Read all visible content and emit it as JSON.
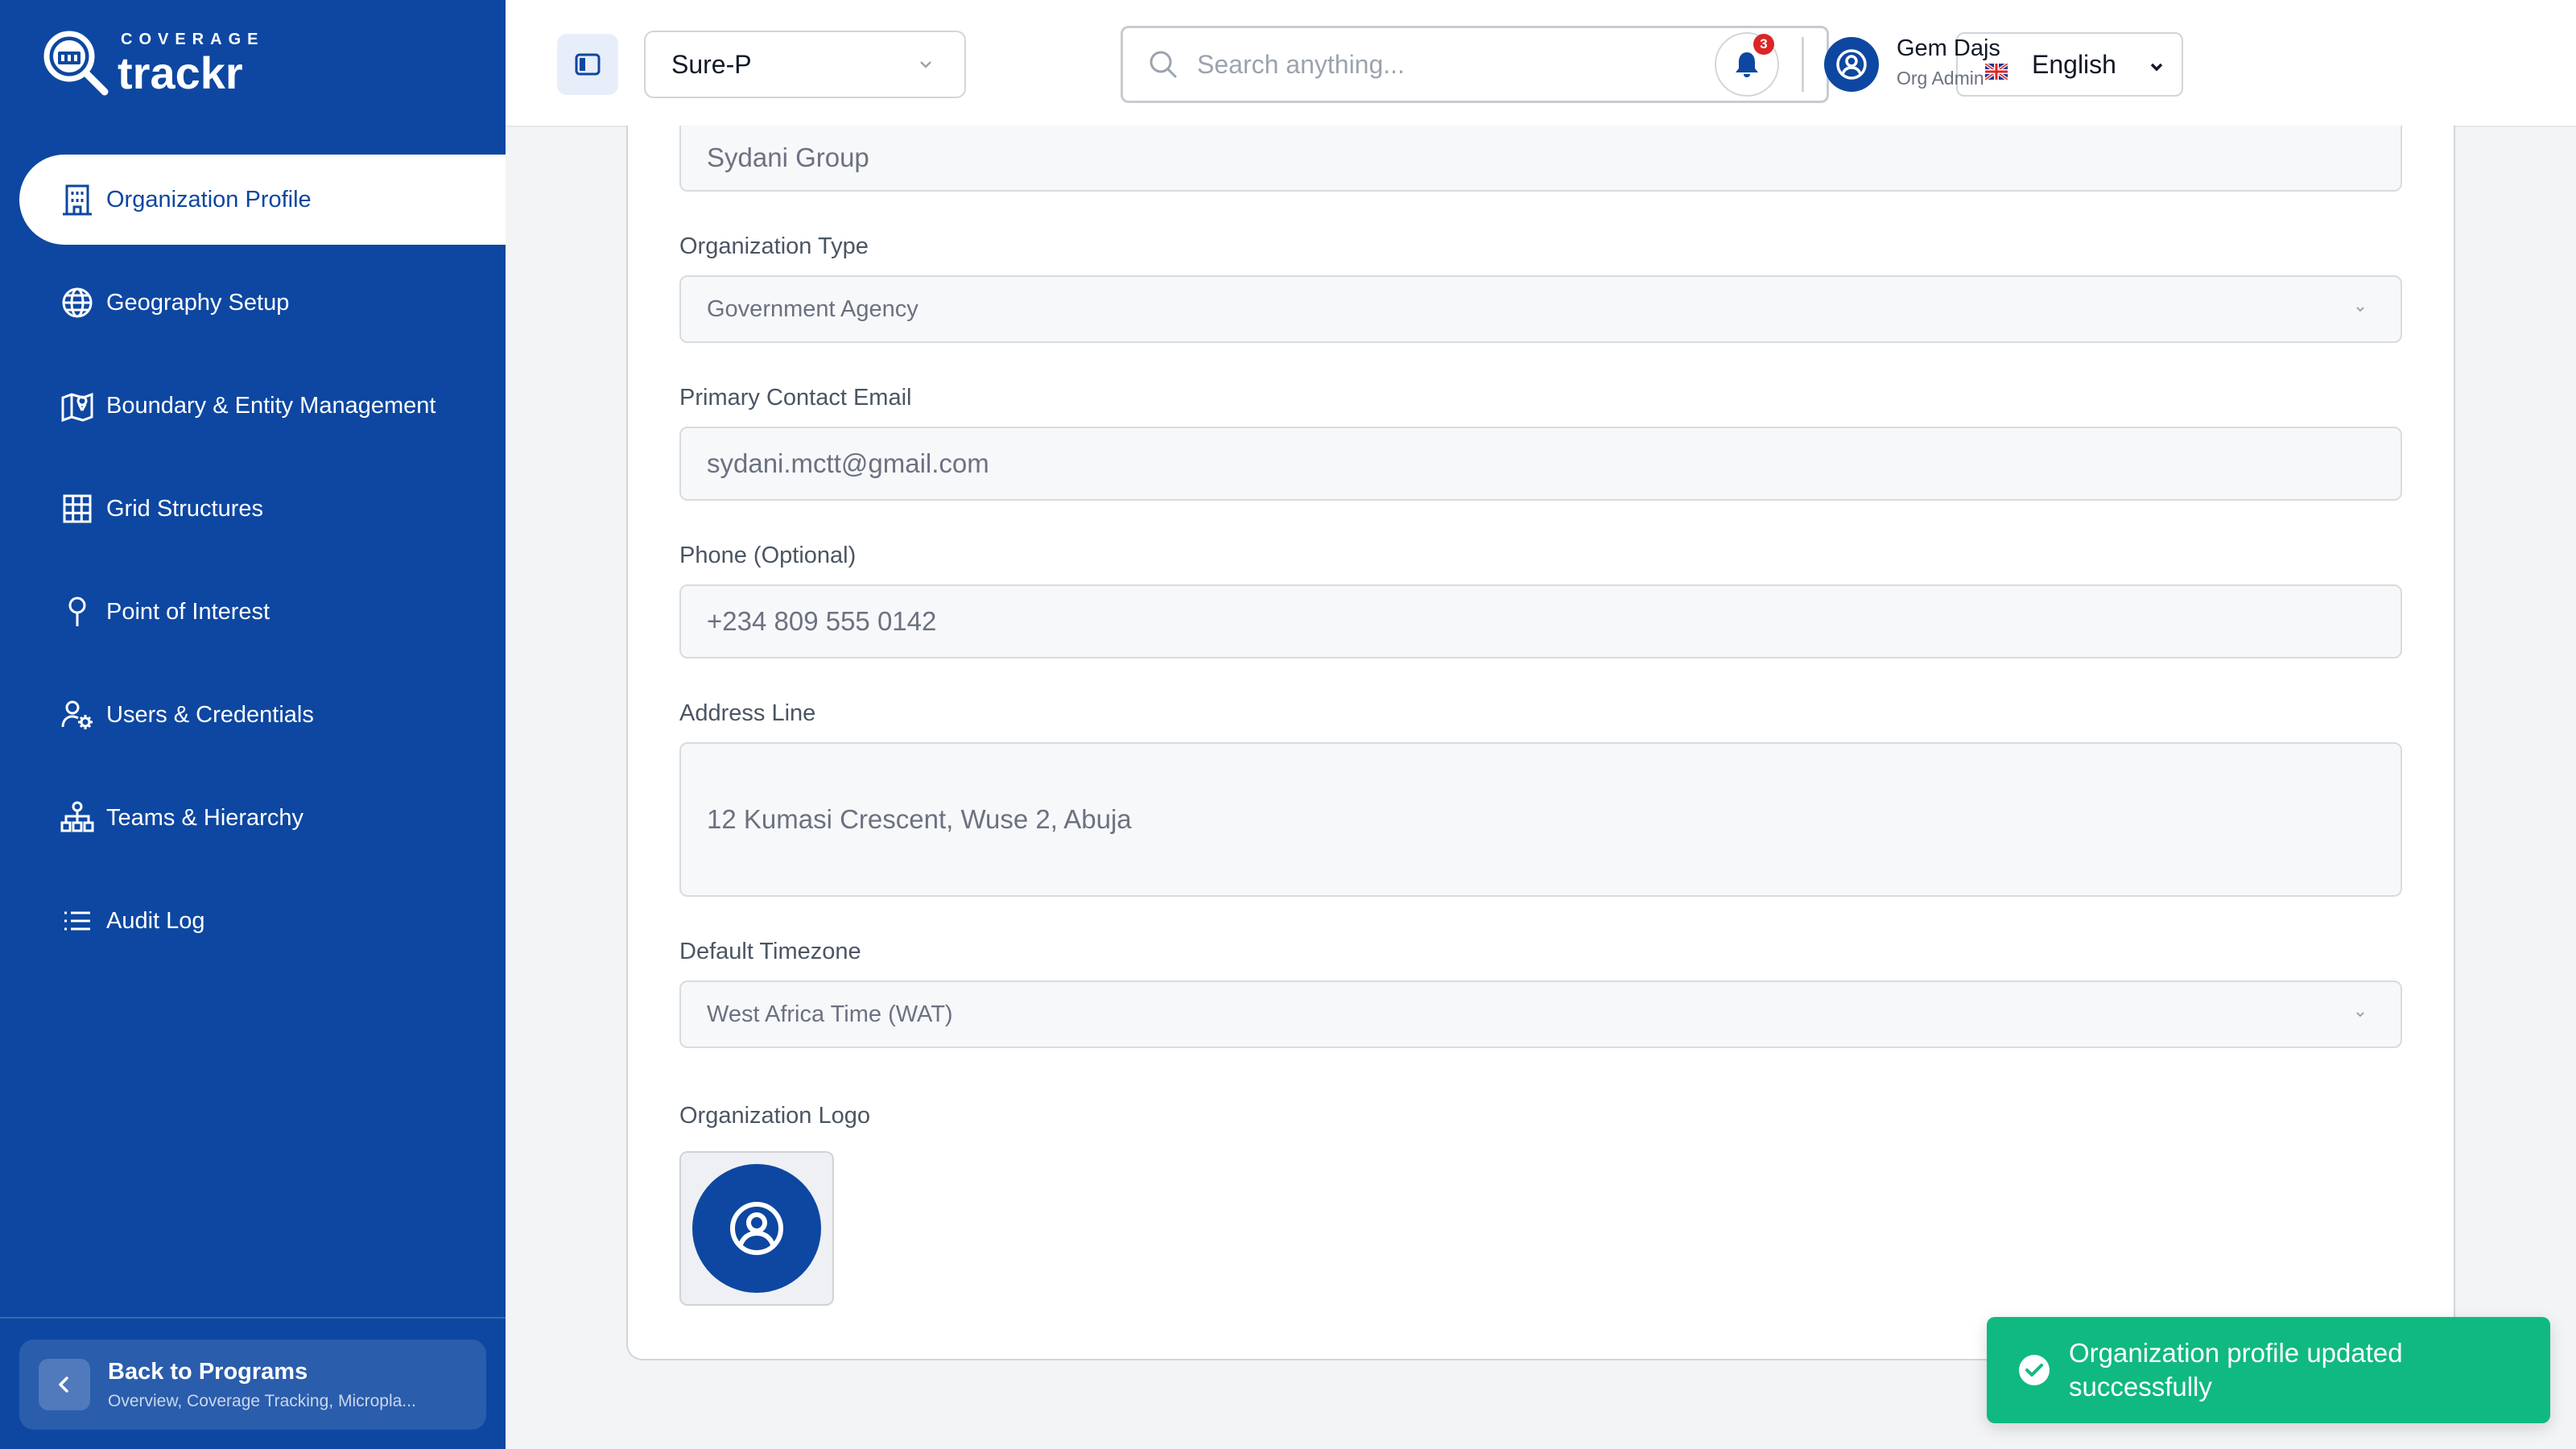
{
  "brand": {
    "small": "COVERAGE",
    "large": "trackr"
  },
  "sidebar": {
    "items": [
      {
        "label": "Organization Profile",
        "icon": "building-icon",
        "active": true
      },
      {
        "label": "Geography Setup",
        "icon": "globe-icon"
      },
      {
        "label": "Boundary & Entity Management",
        "icon": "map-pin-icon"
      },
      {
        "label": "Grid Structures",
        "icon": "grid-icon"
      },
      {
        "label": "Point of Interest",
        "icon": "location-pin-icon"
      },
      {
        "label": "Users & Credentials",
        "icon": "user-settings-icon"
      },
      {
        "label": "Teams & Hierarchy",
        "icon": "hierarchy-icon"
      },
      {
        "label": "Audit Log",
        "icon": "list-icon"
      }
    ],
    "back": {
      "title": "Back to Programs",
      "subtitle": "Overview, Coverage Tracking, Micropla..."
    }
  },
  "header": {
    "program": "Sure-P",
    "search_placeholder": "Search anything...",
    "language": "English",
    "notifications": "3",
    "user_name": "Gem Dajs",
    "user_role": "Org Admin"
  },
  "form": {
    "org_name_value": "Sydani Group",
    "org_type_label": "Organization Type",
    "org_type_value": "Government Agency",
    "email_label": "Primary Contact Email",
    "email_value": "sydani.mctt@gmail.com",
    "phone_label": "Phone (Optional)",
    "phone_value": "+234 809 555 0142",
    "address_label": "Address Line",
    "address_value": "12 Kumasi Crescent, Wuse 2, Abuja",
    "timezone_label": "Default Timezone",
    "timezone_value": "West Africa Time (WAT)",
    "logo_label": "Organization Logo"
  },
  "toast": {
    "message": "Organization profile updated successfully"
  },
  "colors": {
    "primary": "#0d47a1",
    "success": "#10b981",
    "badge": "#dc2626"
  }
}
